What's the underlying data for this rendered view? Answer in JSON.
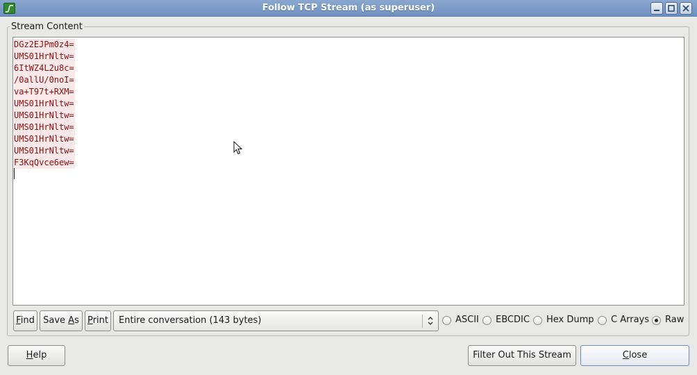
{
  "window": {
    "title": "Follow TCP Stream (as superuser)",
    "app_icon": "wireshark-fin-icon",
    "controls": [
      "minimize-icon",
      "maximize-icon",
      "close-icon"
    ]
  },
  "stream": {
    "group_label": "Stream Content",
    "lines": [
      "DGz2EJPm0z4=",
      "UMS01HrNltw=",
      "6ItWZ4L2u8c=",
      "/0allU/0noI=",
      "va+T97t+RXM=",
      "UMS01HrNltw=",
      "UMS01HrNltw=",
      "UMS01HrNltw=",
      "UMS01HrNltw=",
      "UMS01HrNltw=",
      "F3KqQvce6ew="
    ],
    "text_color": "#8a0e0e",
    "highlight_color": "#fbe8e8"
  },
  "toolbar": {
    "find": {
      "pre": "",
      "accel": "F",
      "post": "ind"
    },
    "save_as": {
      "pre": "Save ",
      "accel": "A",
      "post": "s"
    },
    "print": {
      "pre": "",
      "accel": "P",
      "post": "rint"
    },
    "conversation_select": "Entire conversation (143 bytes)",
    "formats": [
      {
        "label": "ASCII",
        "checked": false
      },
      {
        "label": "EBCDIC",
        "checked": false
      },
      {
        "label": "Hex Dump",
        "checked": false
      },
      {
        "label": "C Arrays",
        "checked": false
      },
      {
        "label": "Raw",
        "checked": true
      }
    ]
  },
  "footer": {
    "help": {
      "pre": "",
      "accel": "H",
      "post": "elp"
    },
    "filter_out": "Filter Out This Stream",
    "close": {
      "pre": "",
      "accel": "C",
      "post": "lose"
    }
  }
}
